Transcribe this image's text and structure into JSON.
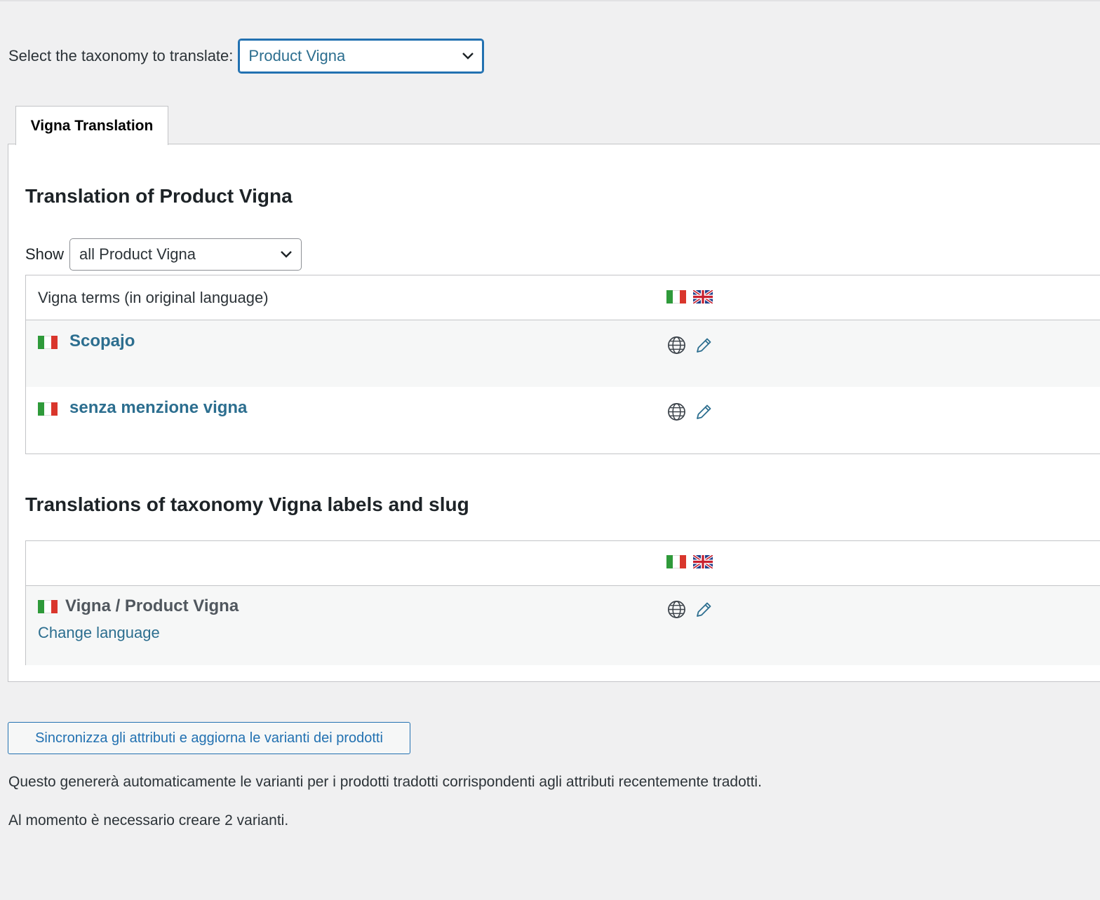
{
  "taxonomy_selector": {
    "label": "Select the taxonomy to translate:",
    "selected": "Product Vigna"
  },
  "tab": {
    "label": "Vigna Translation"
  },
  "terms_section": {
    "title": "Translation of Product Vigna",
    "show_label": "Show",
    "show_selected": "all Product Vigna",
    "header_label": "Vigna terms (in original language)",
    "languages": [
      "it",
      "en"
    ],
    "rows": [
      {
        "name": "Scopajo",
        "flag": "it"
      },
      {
        "name": "senza menzione vigna",
        "flag": "it"
      }
    ]
  },
  "labels_section": {
    "title": "Translations of taxonomy Vigna labels and slug",
    "row_title": "Vigna / Product Vigna",
    "change_language": "Change language"
  },
  "footer": {
    "sync_button": "Sincronizza gli attributi e aggiorna le varianti dei prodotti",
    "note_1": "Questo genererà automaticamente le varianti per i prodotti tradotti corrispondenti agli attributi recentemente tradotti.",
    "note_2": "Al momento è necessario creare 2 varianti."
  },
  "icons": {
    "flag_it": "italian-flag-icon",
    "flag_en": "uk-flag-icon",
    "translate": "globe-icon",
    "edit": "pencil-icon",
    "dropdown": "chevron-down-icon"
  },
  "colors": {
    "link": "#2c6e8f",
    "accent": "#2271b1",
    "background": "#f0f0f1"
  }
}
